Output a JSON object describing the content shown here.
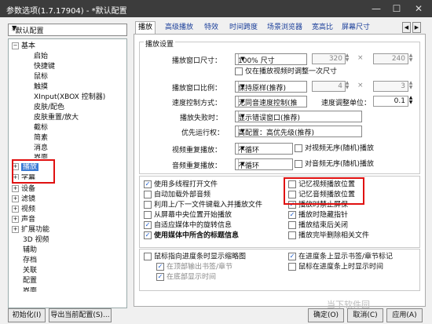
{
  "window": {
    "title": "参数选项(1.7.17904) - *默认配置"
  },
  "profile": {
    "value": "*默认配置"
  },
  "tree": {
    "basic": "基本",
    "basic_children": [
      "启始",
      "快捷键",
      "鼠标",
      "触摸",
      "XInput(XBOX 控制器)",
      "皮肤/配色",
      "皮肤重置/放大",
      "截标",
      "简素",
      "消息",
      "界面"
    ],
    "playback": "播放",
    "subtitles": "字幕",
    "others": [
      "设备",
      "滤镜",
      "视频",
      "声音",
      "扩展功能",
      "3D 视频",
      "辅助",
      "存档",
      "关联",
      "配置",
      "界面"
    ]
  },
  "tabs": [
    "播放",
    "高级播放",
    "特效",
    "时间跨度",
    "场景浏览器",
    "宽高比",
    "屏幕尺寸"
  ],
  "playback_settings": {
    "group_title": "播放设置",
    "window_size_label": "播放窗口尺寸：",
    "window_size_value": "100% 尺寸",
    "width": "320",
    "height": "240",
    "times": "×",
    "only_once": "仅在播放视频时调整一次尺寸",
    "ratio_label": "播放窗口比例：",
    "ratio_value": "保持原样(推荐)",
    "ratio_a": "4",
    "ratio_b": "3",
    "speed_label": "速度控制方式：",
    "speed_value": "无同音速度控制(推",
    "speed_unit_label": "速度调整单位：",
    "speed_unit_value": "0.1",
    "fail_label": "播放失败时：",
    "fail_value": "显示错误窗口(推荐)",
    "priority_label": "优先运行权：",
    "priority_value": "高配置：高优先级(推荐)",
    "video_repeat_label": "视频重复播放：",
    "video_repeat_value": "不循环",
    "video_random": "对视频无序(随机)播放",
    "audio_repeat_label": "音频重复播放：",
    "audio_repeat_value": "不循环",
    "audio_random": "对音频无序(随机)播放"
  },
  "options_left": [
    "使用多线程打开文件",
    "自动加载外部音频",
    "利用上/下一文件键载入并播放文件",
    "从屏幕中央位置开始播放",
    "自适应媒体中的旋转信息",
    "使用媒体中所含的标题信息"
  ],
  "options_left_checked": [
    true,
    false,
    false,
    false,
    true,
    true
  ],
  "options_right": [
    "记忆视频播放位置",
    "记忆音频播放位置",
    "播放时禁止屏保",
    "播放时隐藏指针",
    "播放结束后关闭",
    "播放完毕删除相关文件"
  ],
  "options_right_checked": [
    false,
    false,
    true,
    true,
    false,
    false
  ],
  "thumbs_left": [
    "鼠标指向进度条时显示缩略图",
    "在顶部输出书签/章节",
    "在底部显示时间"
  ],
  "thumbs_right": [
    "在进度条上显示书签/章节标记",
    "鼠标在进度条上时显示时间"
  ],
  "buttons": {
    "init": "初始化(I)",
    "export": "导出当前配置(S)...",
    "ok": "确定(O)",
    "cancel": "取消(C)",
    "apply": "应用(A)"
  },
  "watermark": "当下软件园",
  "icons": [
    "minimize-icon",
    "maximize-icon",
    "close-icon",
    "dropdown-arrow-icon",
    "expand-icon",
    "collapse-icon",
    "check-icon",
    "spin-up-icon",
    "spin-down-icon",
    "tab-prev-icon",
    "tab-next-icon"
  ],
  "colors": {
    "titlebar": "#3c3c3c",
    "selection": "#3b7bd4",
    "highlight_box": "#e01010",
    "link_tab": "#1a3e9a"
  }
}
